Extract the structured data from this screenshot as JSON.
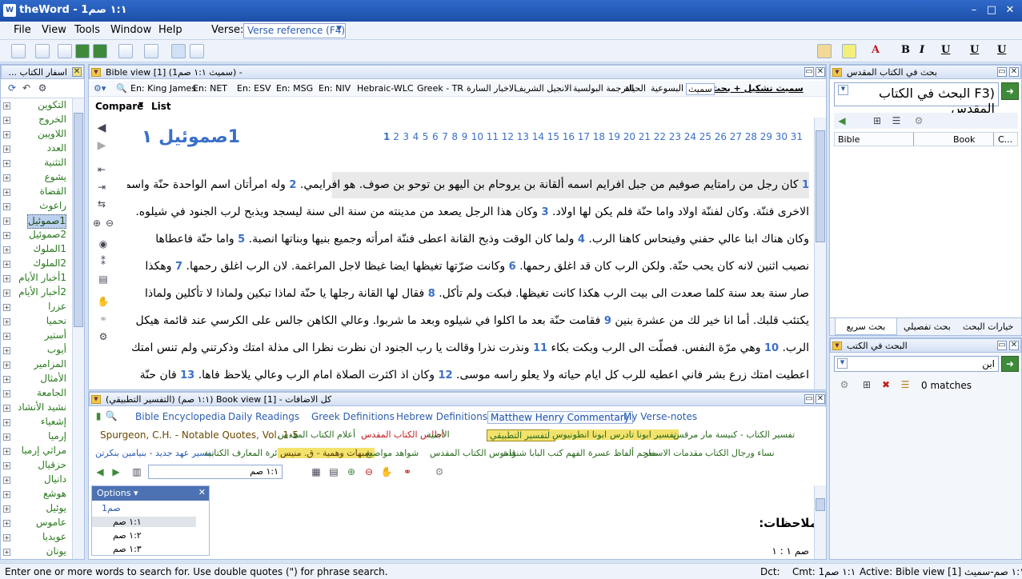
{
  "window": {
    "title": "theWord - ١:١ صم1"
  },
  "menu": {
    "file": "File",
    "view": "View",
    "tools": "Tools",
    "window": "Window",
    "help": "Help",
    "verse_label": "Verse:",
    "verse_placeholder": "Verse reference (F4)"
  },
  "books_panel": {
    "title": "اسفار الكتاب ...",
    "items": [
      "التكوين",
      "الخروج",
      "اللاويين",
      "العدد",
      "التثنية",
      "يشوع",
      "القضاة",
      "راعوث",
      "1صموئيل",
      "2صموئيل",
      "1الملوك",
      "2الملوك",
      "1أخبار الأيام",
      "2أخبار الأيام",
      "عزرا",
      "نحميا",
      "أستير",
      "أيوب",
      "المزامير",
      "الأمثال",
      "الجامعة",
      "نشيد الأنشاد",
      "إشعياء",
      "إرميا",
      "مراثي إرميا",
      "حزقيال",
      "دانيال",
      "هوشع",
      "يوئيل",
      "عاموس",
      "عوبديا",
      "يونان"
    ],
    "selected_index": 8
  },
  "bible_view": {
    "header": "Bible view [1] (سميث ١:١ صم1) -",
    "translations": [
      "سميث تشكيل + بحث",
      "سميث",
      "البسوعية",
      "الحياة",
      "الترجمة البولسية",
      "الانجيل الشريف",
      "الاخبار السارة",
      "Greek - TR",
      "Hebraic-WLC",
      "En: NIV",
      "En: MSG",
      "En: ESV",
      "En: NET",
      "En: King James"
    ],
    "compare_label": "Compare",
    "list_label": "List",
    "book_title": "1صموئيل ١",
    "chapters": [
      "1",
      "2",
      "3",
      "4",
      "5",
      "6",
      "7",
      "8",
      "9",
      "10",
      "11",
      "12",
      "13",
      "14",
      "15",
      "16",
      "17",
      "18",
      "19",
      "20",
      "21",
      "22",
      "23",
      "24",
      "25",
      "26",
      "27",
      "28",
      "29",
      "30",
      "31"
    ],
    "lines": [
      {
        "v": "1",
        "text": "كان رجل من رامتايم صوفيم من جبل افرايم اسمه ألقانة بن يروحام بن اليهو بن توحو بن صوف. هو افرايمي.",
        "v2": "2",
        "text2": "وله امرأتان اسم الواحدة حنّة واسم"
      },
      {
        "text": "الاخرى فننّة. وكان لفننّة اولاد واما حنّة فلم يكن لها اولاد.",
        "v2": "3",
        "text2": "وكان هذا الرجل يصعد من مدينته من سنة الى سنة ليسجد ويذبح لرب الجنود في شيلوه."
      },
      {
        "text": "وكان هناك ابنا عالي حفني وفينحاس كاهنا الرب.",
        "v2": "4",
        "text2": "ولما كان الوقت وذبح القانة اعطى فننّة امرأته وجميع بنيها وبناتها انصبة.",
        "v3": "5",
        "text3": "واما حنّة فاعطاها"
      },
      {
        "text": "نصيب اثنين لانه كان يحب حنّة. ولكن الرب كان قد اغلق رحمها.",
        "v2": "6",
        "text2": "وكانت ضرّتها تغيظها ايضا غيظا لاجل المراغمة. لان الرب اغلق رحمها.",
        "v3": "7",
        "text3": "وهكذا"
      },
      {
        "text": "صار سنة بعد سنة كلما صعدت الى بيت الرب هكذا كانت تغيظها. فبكت ولم تأكل.",
        "v2": "8",
        "text2": "فقال لها القانة رجلها يا حنّة لماذا تبكين ولماذا لا تأكلين ولماذا"
      },
      {
        "text": "يكتئب قلبك. أما انا خير لك من عشرة بنين",
        "v2": "9",
        "text2": "فقامت حنّة بعد ما اكلوا في شيلوه وبعد ما شربوا. وعالي الكاهن جالس على الكرسي عند قائمة هيكل"
      },
      {
        "text": "الرب.",
        "v2": "10",
        "text2": "وهي مرّة النفس. فصلّت الى الرب وبكت بكاء",
        "v3": "11",
        "text3": "ونذرت نذرا وقالت يا رب الجنود ان نظرت نظرا الى مذلة امتك وذكرتني ولم تنس امتك بل"
      },
      {
        "text": "اعطيت امتك زرع بشر فاني اعطيه للرب كل ايام حياته ولا يعلو راسه موسى.",
        "v2": "12",
        "text2": "وكان اذ اكثرت الصلاة امام الرب وعالي يلاحظ فاها.",
        "v3": "13",
        "text3": "فان حنّة"
      }
    ]
  },
  "book_view": {
    "header": "كل الاضافات - Book view [1] (١:١ صم) (التفسير التطبيقي)",
    "modules_row1": [
      "Bible Encyclopedia",
      "Daily Readings",
      "Greek Definitions",
      "Hebrew Definitions",
      "Matthew Henry Commentary",
      "My Verse-notes"
    ],
    "modules_row2": [
      "Spurgeon, C.H. - Notable Quotes, Vol. 1-5",
      "أعلام الكتاب المقدس",
      "اطلس الكتاب المقدس",
      "الأجبية",
      "التفسير التطبيقي",
      "تفسير ابونا انطونيوس",
      "تفسير ابونا تادرس",
      "تفسير الكتاب - كنيسة مار مرقس"
    ],
    "modules_row3": [
      "تفسير عهد جديد - بنيامين بنكرتن",
      "دائرة المعارف الكتابية",
      "شبهات وهمية - ق. منيس",
      "شواهد مواضيع",
      "قاموس الكتاب المقدس",
      "كتب البابا شنودة",
      "معجم ألفاظ عسرة الفهم",
      "مقدمات الاسفار",
      "نساء ورجال الكتاب"
    ],
    "ref_box": "١:١ صم",
    "options_label": "Options",
    "tree": [
      "صم1",
      "١:١ صم",
      "١:٢ صم",
      "١:٣ صم"
    ],
    "notes_title": "ملاحظات:",
    "notes_ref": "صم ١ : ١"
  },
  "search_panel": {
    "title": "بحث في الكتاب المقدس",
    "query_label": "(F3 البحث في الكتاب المقدس",
    "col_bible": "Bible",
    "col_book": "Book",
    "col_c": "C...",
    "tabs": [
      "خيارات البحث",
      "بحث تفصيلي",
      "بحث سريع"
    ]
  },
  "search_books": {
    "title": "البحث في الكتب",
    "query": "ابن",
    "matches": "0 matches"
  },
  "status": {
    "hint": "Enter one or more words to search for. Use double quotes (\") for phrase search.",
    "dct": "Dct:",
    "cmt": "Cmt: ١:١ صم1",
    "active": "Active: Bible view [1] ١:١ صم-سميث"
  }
}
